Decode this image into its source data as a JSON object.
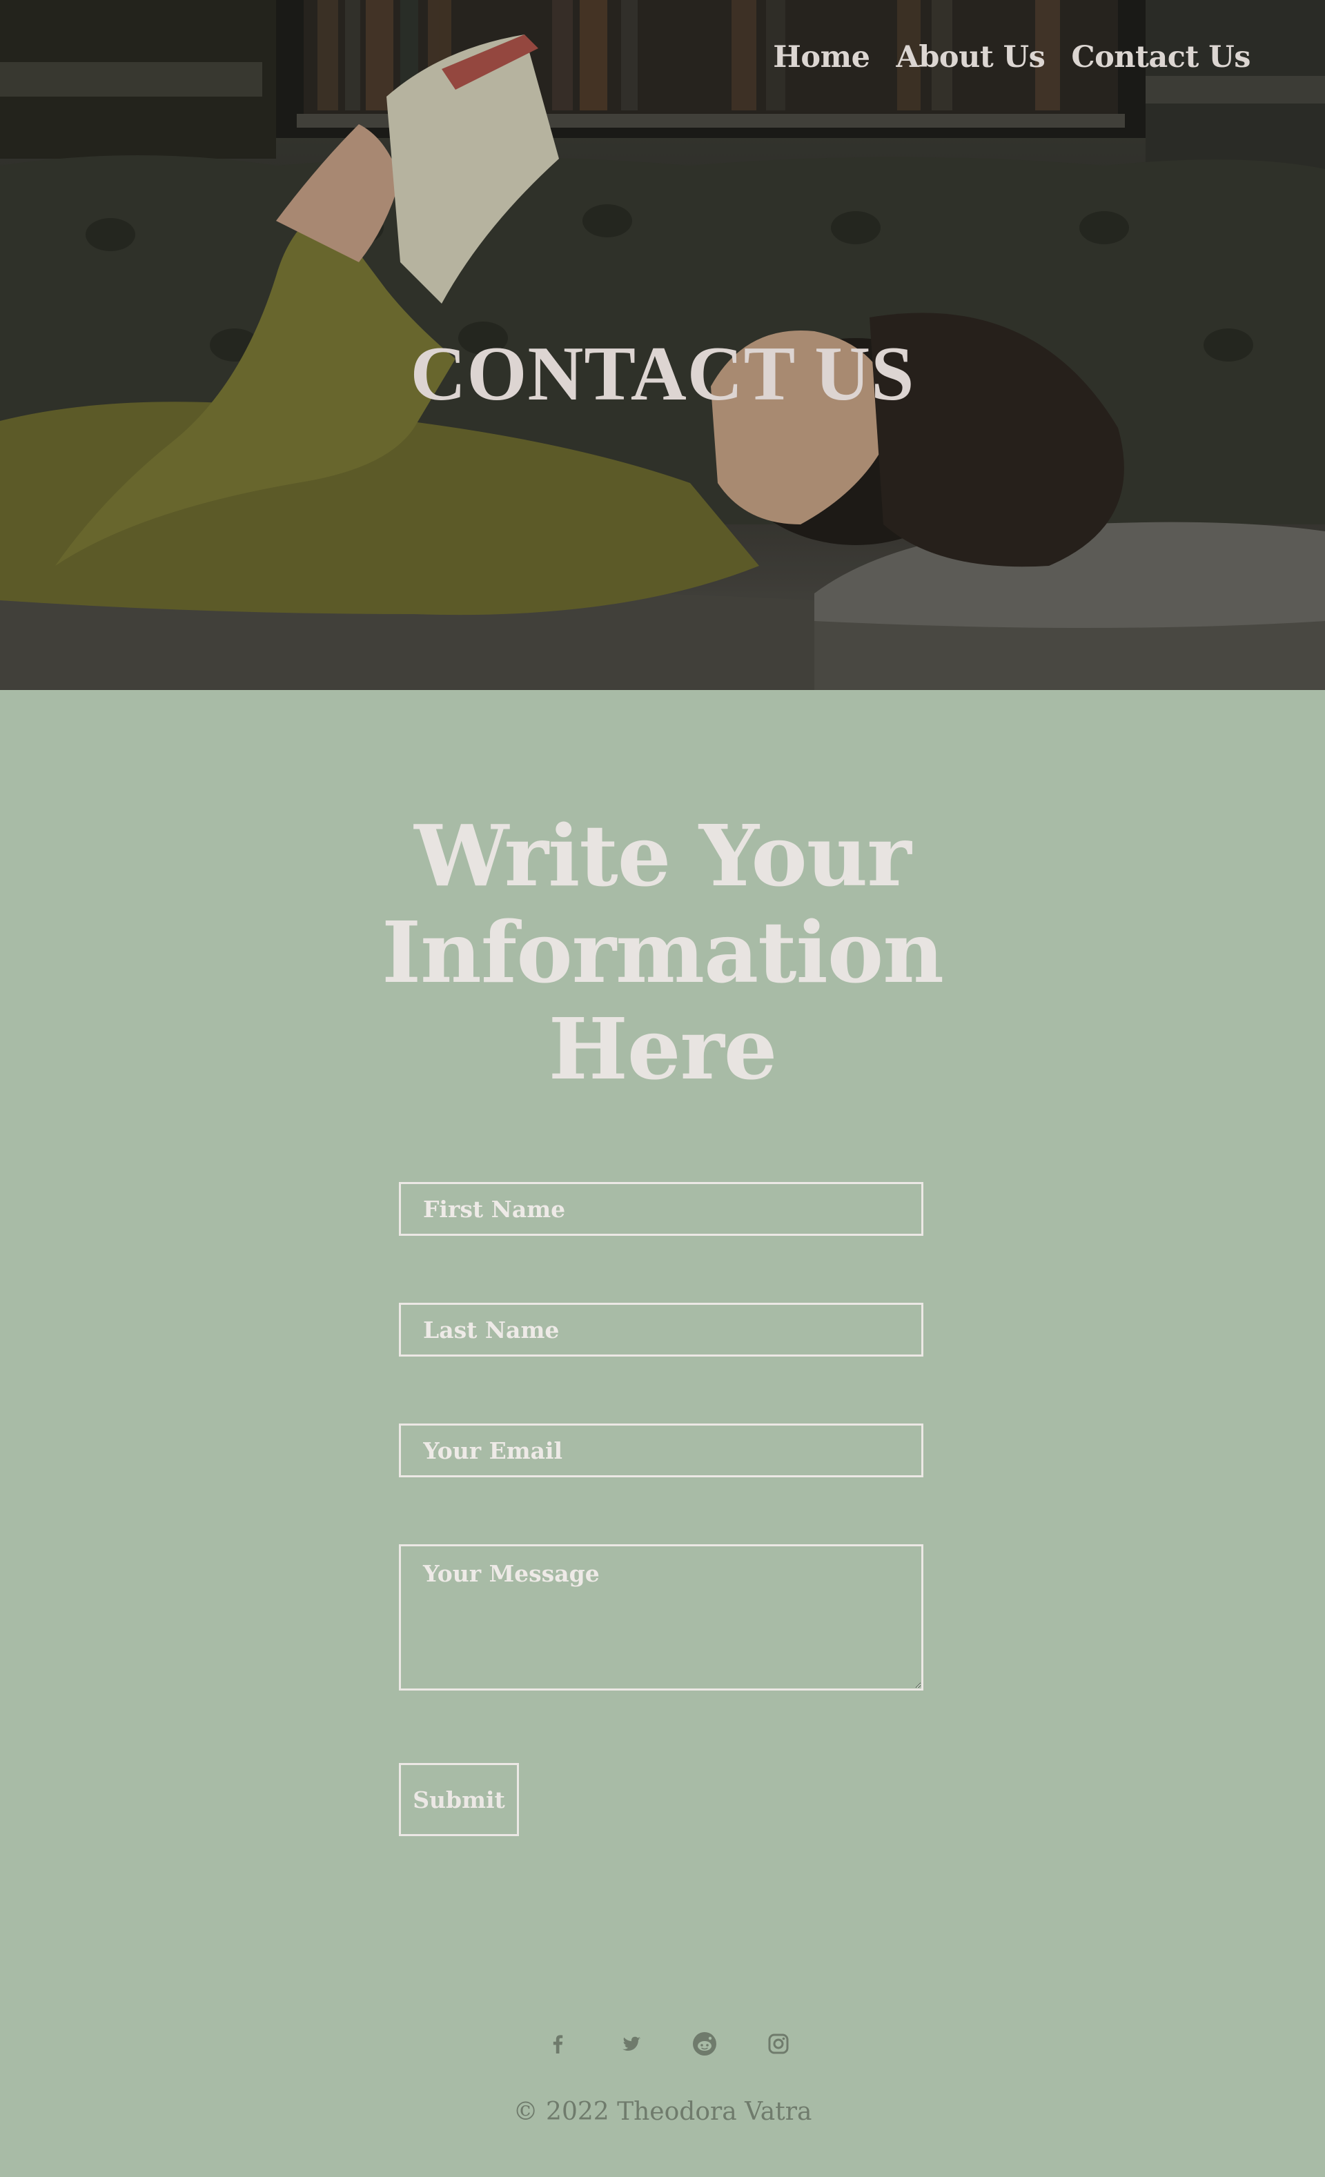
{
  "nav": {
    "items": [
      {
        "label": "Home"
      },
      {
        "label": "About Us"
      },
      {
        "label": "Contact Us"
      }
    ]
  },
  "hero": {
    "title": "CONTACT US"
  },
  "form": {
    "heading": "Write Your Information Here",
    "first_name_placeholder": "First Name",
    "last_name_placeholder": "Last Name",
    "email_placeholder": "Your Email",
    "message_placeholder": "Your Message",
    "submit_label": "Submit"
  },
  "footer": {
    "social": [
      "facebook-icon",
      "twitter-icon",
      "reddit-icon",
      "instagram-icon"
    ],
    "copyright": "© 2022 Theodora Vatra"
  },
  "colors": {
    "page_background": "#a8bba6",
    "text_light": "#e8e4e1",
    "footer_text": "#6f7b6c"
  }
}
